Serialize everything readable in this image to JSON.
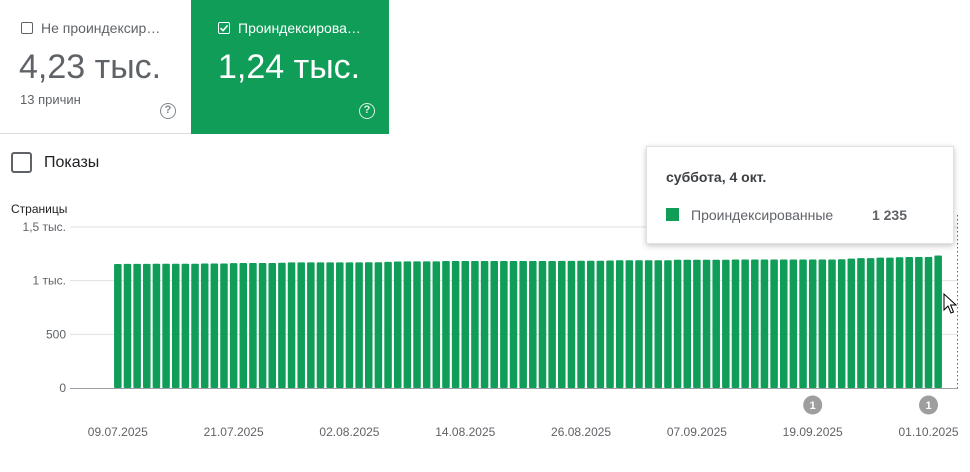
{
  "cards": {
    "not_indexed": {
      "label": "Не проиндексир…",
      "value": "4,23 тыс.",
      "sub": "13 причин",
      "checked": false
    },
    "indexed": {
      "label": "Проиндексирова…",
      "value": "1,24 тыс.",
      "checked": true
    }
  },
  "help_glyph": "?",
  "shows": {
    "label": "Показы",
    "checked": false
  },
  "tooltip": {
    "date": "суббота, 4 окт.",
    "series": "Проиндексированные",
    "value": "1 235"
  },
  "colors": {
    "indexed": "#0f9d58",
    "grid": "#e0e0e0",
    "axis": "#9aa0a6",
    "annotation": "#9e9e9e"
  },
  "chart_data": {
    "type": "bar",
    "ylabel": "Страницы",
    "ylim": [
      0,
      1500
    ],
    "yticks": [
      {
        "value": 0,
        "label": "0"
      },
      {
        "value": 500,
        "label": "500"
      },
      {
        "value": 1000,
        "label": "1 тыс."
      },
      {
        "value": 1500,
        "label": "1,5 тыс."
      }
    ],
    "grid": true,
    "start_date": "2025-07-09",
    "xtick_labels": [
      "09.07.2025",
      "21.07.2025",
      "02.08.2025",
      "14.08.2025",
      "26.08.2025",
      "07.09.2025",
      "19.09.2025",
      "01.10.2025"
    ],
    "series": [
      {
        "name": "Проиндексированные",
        "values": [
          1155,
          1157,
          1157,
          1157,
          1158,
          1158,
          1158,
          1158,
          1158,
          1160,
          1160,
          1160,
          1163,
          1165,
          1165,
          1165,
          1165,
          1167,
          1170,
          1170,
          1170,
          1170,
          1170,
          1170,
          1170,
          1170,
          1172,
          1172,
          1175,
          1178,
          1180,
          1180,
          1180,
          1180,
          1183,
          1183,
          1183,
          1183,
          1183,
          1183,
          1183,
          1183,
          1183,
          1183,
          1183,
          1183,
          1184,
          1184,
          1185,
          1185,
          1186,
          1188,
          1190,
          1190,
          1190,
          1190,
          1190,
          1190,
          1195,
          1195,
          1195,
          1195,
          1195,
          1195,
          1197,
          1197,
          1197,
          1197,
          1197,
          1197,
          1197,
          1197,
          1197,
          1197,
          1197,
          1200,
          1205,
          1210,
          1210,
          1215,
          1215,
          1218,
          1220,
          1220,
          1221,
          1235
        ]
      }
    ],
    "selected_date": "2025-10-04",
    "annotations": [
      {
        "date": "2025-09-19",
        "label": "1"
      },
      {
        "date": "2025-10-01",
        "label": "1"
      }
    ]
  }
}
